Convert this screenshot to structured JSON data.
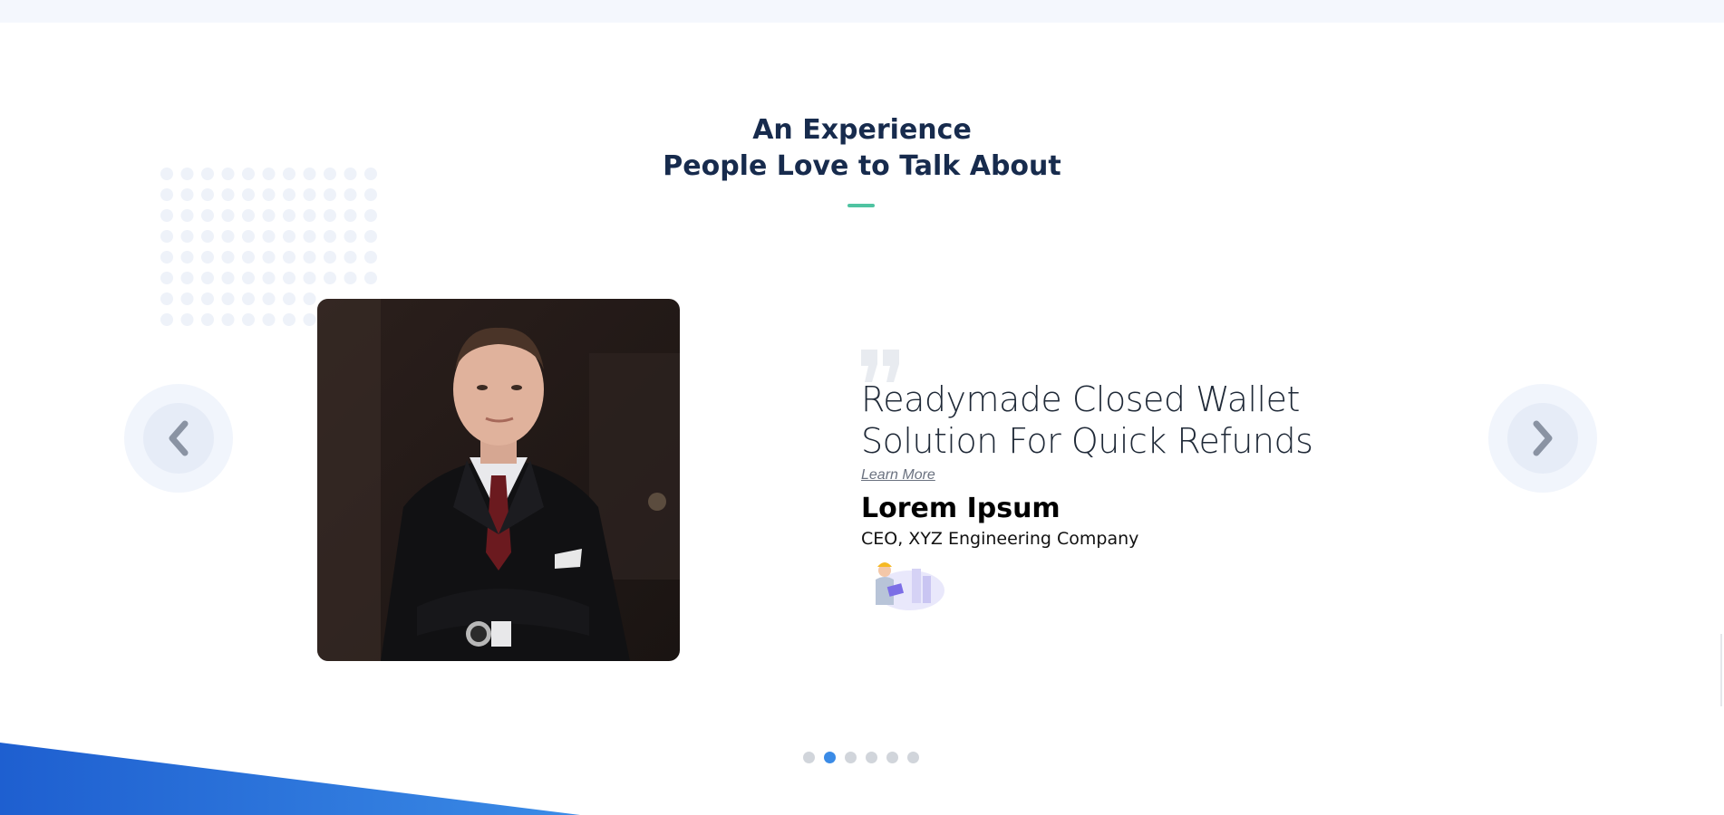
{
  "section": {
    "heading_line1": "An Experience",
    "heading_line2": "People Love to Talk About",
    "accent_color": "#4fc3a1",
    "heading_color": "#172b4d"
  },
  "carousel": {
    "prev_icon": "chevron-left-icon",
    "next_icon": "chevron-right-icon",
    "active_index": 1,
    "slide_count": 6
  },
  "testimonial": {
    "title": "Readymade Closed Wallet Solution For Quick Refunds",
    "learn_more": "Learn More",
    "name": "Lorem Ipsum",
    "role": "CEO, XYZ Engineering Company"
  },
  "colors": {
    "active_dot": "#3b8be6",
    "inactive_dot": "#d1d5db",
    "wave": "#1e5fd0"
  }
}
